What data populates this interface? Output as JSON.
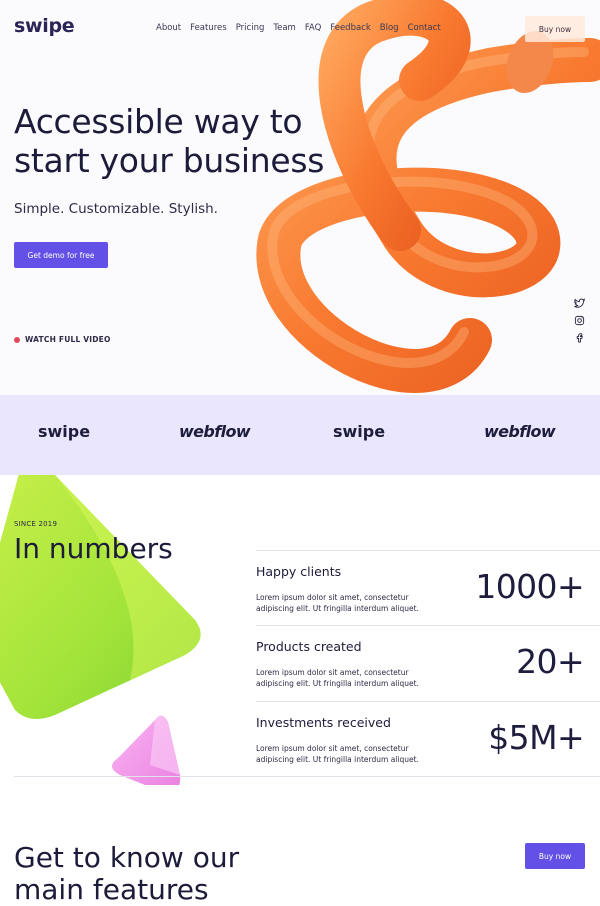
{
  "brand": {
    "name": "swipe"
  },
  "nav": {
    "items": [
      "About",
      "Features",
      "Pricing",
      "Team",
      "FAQ",
      "Feedback",
      "Blog",
      "Contact"
    ]
  },
  "header": {
    "buy_label": "Buy now"
  },
  "hero": {
    "title_line1": "Accessible way to",
    "title_line2": "start your business",
    "subtitle": "Simple. Customizable. Stylish.",
    "cta_label": "Get demo for free",
    "watch_label": "WATCH FULL VIDEO"
  },
  "social": {
    "icons": [
      "twitter-icon",
      "instagram-icon",
      "facebook-icon"
    ]
  },
  "logos": {
    "items": [
      "swipe",
      "webflow",
      "swipe",
      "webflow"
    ]
  },
  "numbers": {
    "eyebrow": "SINCE 2019",
    "title": "In numbers",
    "stats": [
      {
        "label": "Happy clients",
        "desc_line1": "Lorem ipsum dolor sit amet, consectetur",
        "desc_line2": "adipiscing elit. Ut fringilla interdum aliquet.",
        "value": "1000+"
      },
      {
        "label": "Products created",
        "desc_line1": "Lorem ipsum dolor sit amet, consectetur",
        "desc_line2": "adipiscing elit. Ut fringilla interdum aliquet.",
        "value": "20+"
      },
      {
        "label": "Investments received",
        "desc_line1": "Lorem ipsum dolor sit amet, consectetur",
        "desc_line2": "adipiscing elit. Ut fringilla interdum aliquet.",
        "value": "$5M+"
      }
    ]
  },
  "features": {
    "title_line1": "Get to know our",
    "title_line2": "main features",
    "buy_label": "Buy now"
  },
  "colors": {
    "accent": "#6350e6",
    "dark": "#1d1b3a",
    "logo_band": "#e9e6fd",
    "orange": "#f57a3a",
    "green": "#a6e83a",
    "pink": "#f08ce6"
  }
}
